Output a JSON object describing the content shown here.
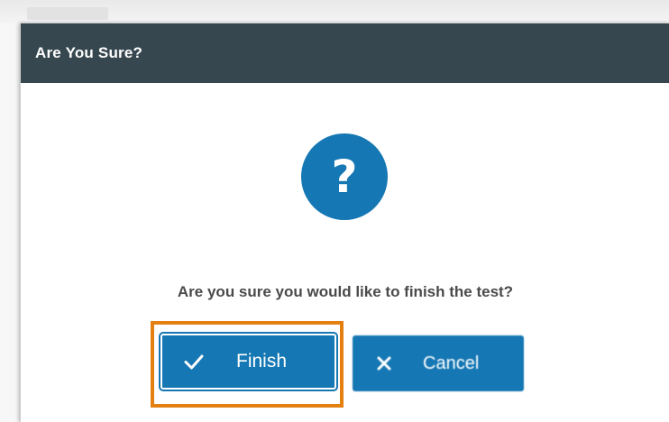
{
  "dialog": {
    "title": "Are You Sure?",
    "icon": "question-icon",
    "icon_glyph": "?",
    "message": "Are you sure you would like to finish the test?",
    "buttons": {
      "finish_label": "Finish",
      "finish_icon": "check-icon",
      "cancel_label": "Cancel",
      "cancel_icon": "close-icon"
    }
  },
  "colors": {
    "titlebar": "#37474f",
    "primary": "#1577b3",
    "highlight": "#e47f12"
  }
}
